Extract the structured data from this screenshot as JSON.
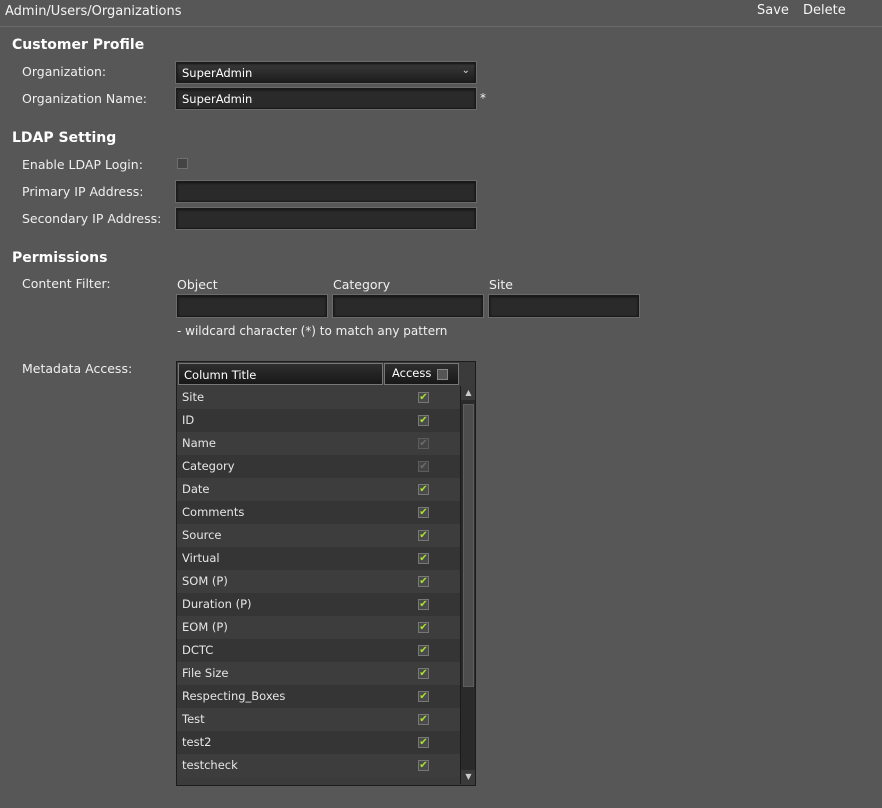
{
  "header": {
    "breadcrumb": "Admin/Users/Organizations",
    "save_label": "Save",
    "delete_label": "Delete"
  },
  "customer_profile": {
    "title": "Customer Profile",
    "organization_label": "Organization:",
    "organization_value": "SuperAdmin",
    "organization_name_label": "Organization Name:",
    "organization_name_value": "SuperAdmin",
    "required_marker": "*"
  },
  "ldap": {
    "title": "LDAP Setting",
    "enable_label": "Enable LDAP Login:",
    "enabled": false,
    "primary_ip_label": "Primary IP Address:",
    "primary_ip_value": "",
    "secondary_ip_label": "Secondary IP Address:",
    "secondary_ip_value": ""
  },
  "permissions": {
    "title": "Permissions",
    "content_filter_label": "Content Filter:",
    "filter_columns": [
      "Object",
      "Category",
      "Site"
    ],
    "filter_values": [
      "",
      "",
      ""
    ],
    "wildcard_hint": "- wildcard character (*) to match any pattern",
    "metadata_access_label": "Metadata Access:",
    "grid": {
      "column_title_header": "Column Title",
      "access_header": "Access",
      "rows": [
        {
          "name": "Site",
          "checked": true,
          "disabled": false
        },
        {
          "name": "ID",
          "checked": true,
          "disabled": false
        },
        {
          "name": "Name",
          "checked": true,
          "disabled": true
        },
        {
          "name": "Category",
          "checked": true,
          "disabled": true
        },
        {
          "name": "Date",
          "checked": true,
          "disabled": false
        },
        {
          "name": "Comments",
          "checked": true,
          "disabled": false
        },
        {
          "name": "Source",
          "checked": true,
          "disabled": false
        },
        {
          "name": "Virtual",
          "checked": true,
          "disabled": false
        },
        {
          "name": "SOM (P)",
          "checked": true,
          "disabled": false
        },
        {
          "name": "Duration (P)",
          "checked": true,
          "disabled": false
        },
        {
          "name": "EOM (P)",
          "checked": true,
          "disabled": false
        },
        {
          "name": "DCTC",
          "checked": true,
          "disabled": false
        },
        {
          "name": "File Size",
          "checked": true,
          "disabled": false
        },
        {
          "name": "Respecting_Boxes",
          "checked": true,
          "disabled": false
        },
        {
          "name": "Test",
          "checked": true,
          "disabled": false
        },
        {
          "name": "test2",
          "checked": true,
          "disabled": false
        },
        {
          "name": "testcheck",
          "checked": true,
          "disabled": false
        }
      ]
    }
  },
  "icons": {
    "dropdown": "chevron-down-icon",
    "check": "check-icon",
    "scroll_up": "scroll-up-icon",
    "scroll_down": "scroll-down-icon"
  },
  "colors": {
    "background": "#575757",
    "field": "#2a2a2a",
    "check": "#a6e22e"
  }
}
